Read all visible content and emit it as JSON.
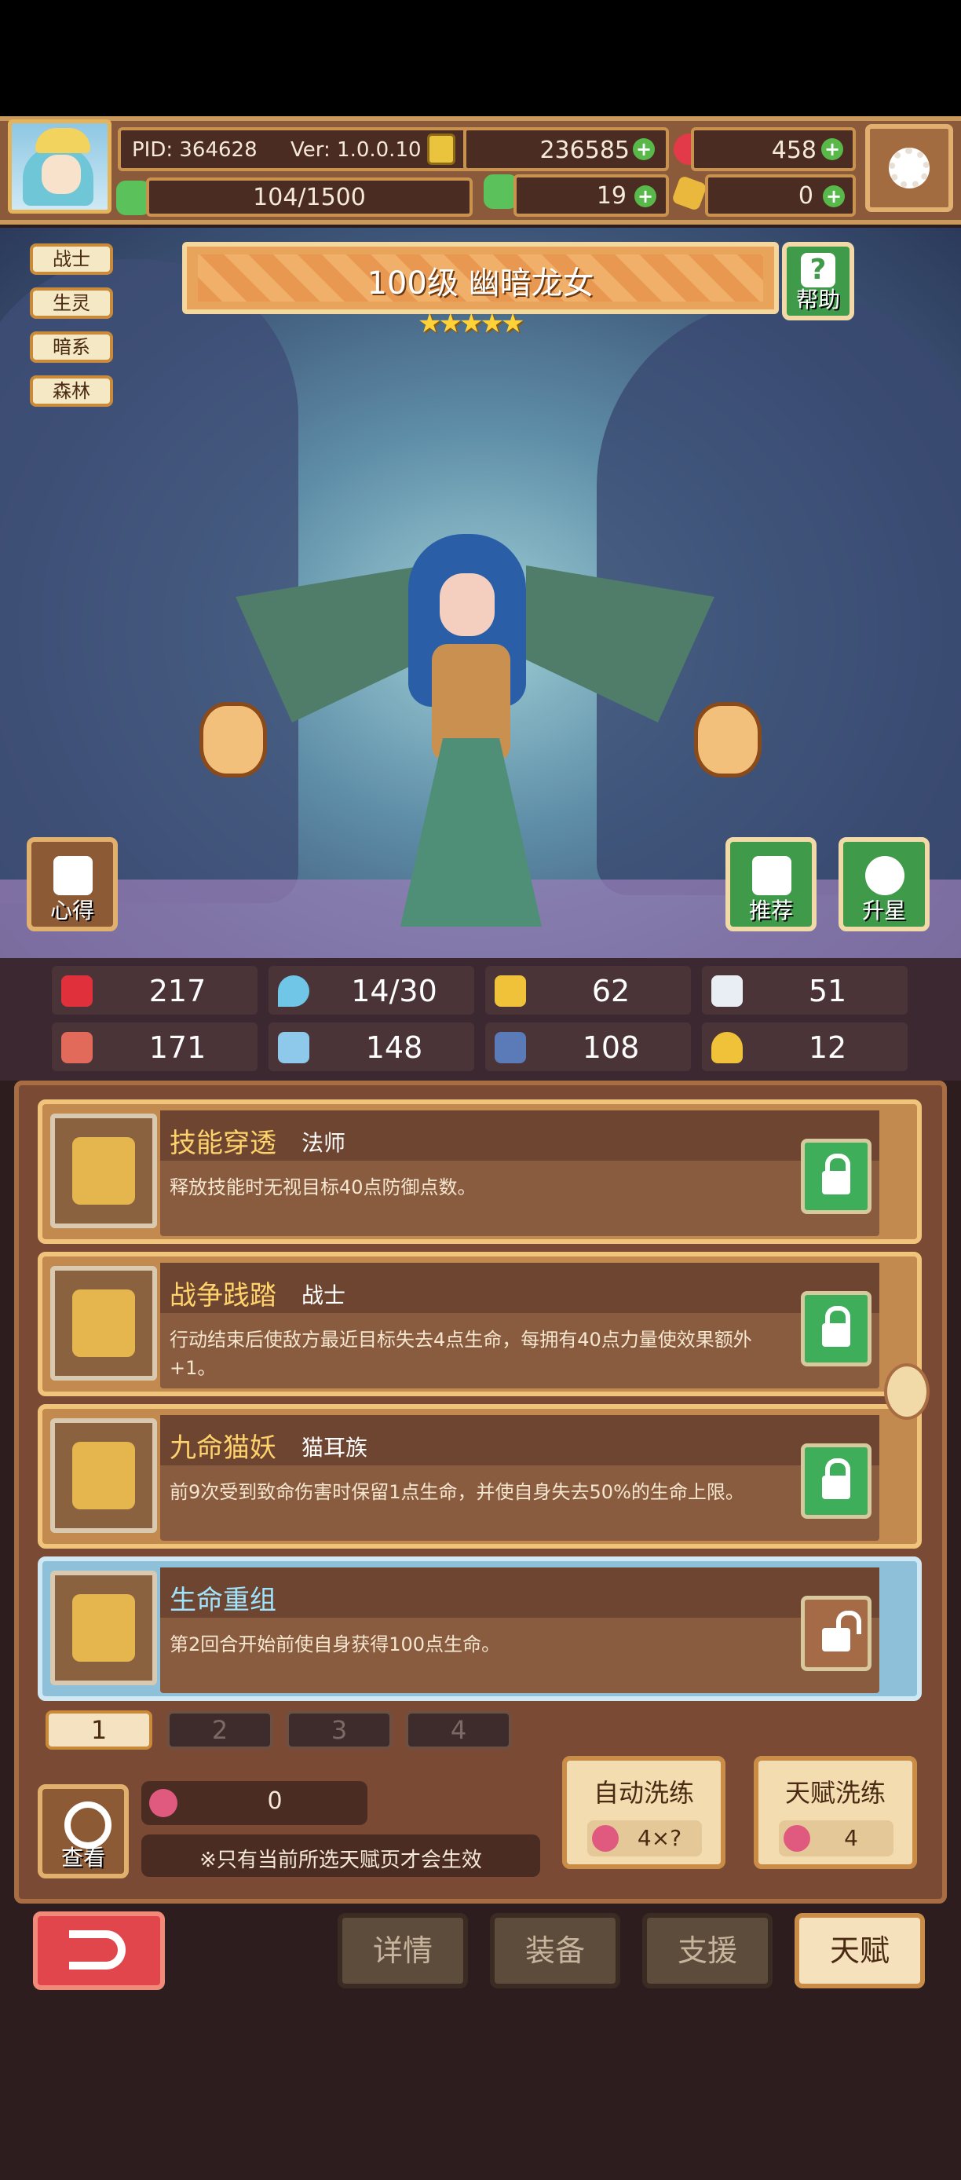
{
  "header": {
    "pid": "PID: 364628",
    "version": "Ver: 1.0.0.10",
    "gold": "236585",
    "gems": "458",
    "stamina": "104/1500",
    "clovers": "19",
    "keys": "0"
  },
  "tags": [
    "战士",
    "生灵",
    "暗系",
    "森林"
  ],
  "hero": {
    "title": "100级 幽暗龙女",
    "stars": "★★★★★",
    "help_label": "帮助",
    "notes_label": "心得",
    "recommend_label": "推荐",
    "upgrade_star_label": "升星"
  },
  "stats": [
    "217",
    "14/30",
    "62",
    "51",
    "171",
    "148",
    "108",
    "12"
  ],
  "talents": [
    {
      "name": "技能穿透",
      "class": "法师",
      "desc": "释放技能时无视目标40点防御点数。"
    },
    {
      "name": "战争践踏",
      "class": "战士",
      "desc": "行动结束后使敌方最近目标失去4点生命，每拥有40点力量使效果额外+1。"
    },
    {
      "name": "九命猫妖",
      "class": "猫耳族",
      "desc": "前9次受到致命伤害时保留1点生命，并使自身失去50%的生命上限。"
    },
    {
      "name": "生命重组",
      "class": "",
      "desc": "第2回合开始前使自身获得100点生命。"
    }
  ],
  "pages": [
    "1",
    "2",
    "3",
    "4"
  ],
  "footer": {
    "fruit_count": "0",
    "notice": "※只有当前所选天赋页才会生效",
    "view_label": "查看",
    "auto_train_label": "自动洗练",
    "auto_train_cost": "4×?",
    "talent_train_label": "天赋洗练",
    "talent_train_cost": "4"
  },
  "nav": [
    "详情",
    "装备",
    "支援",
    "天赋"
  ],
  "colors": {
    "accent": "#c98a3a",
    "gold_text": "#ffd36b",
    "selected": "#8ec1d9"
  }
}
